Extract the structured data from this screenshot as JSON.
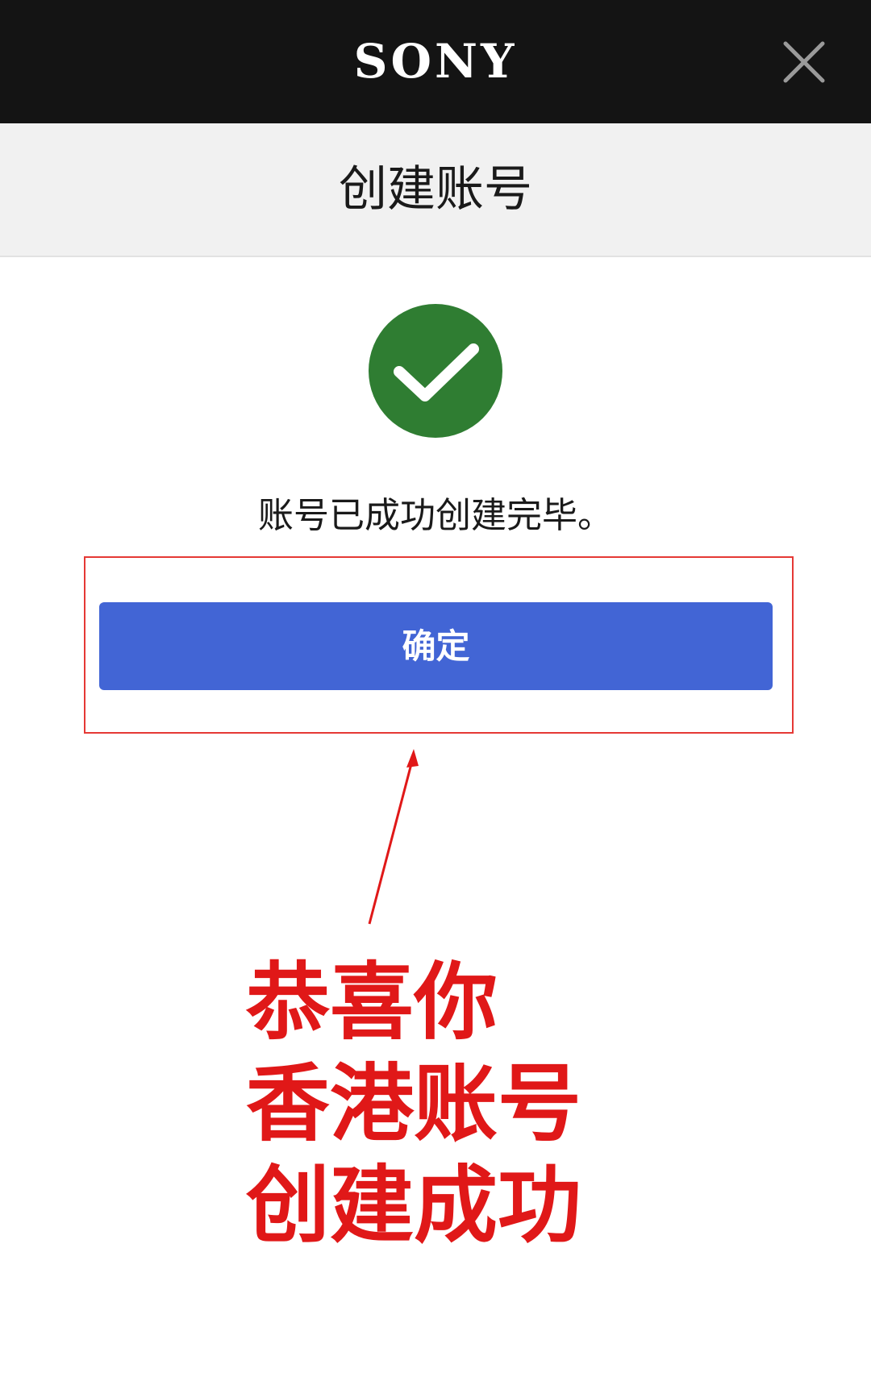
{
  "header": {
    "brand": "SONY",
    "close_icon": "close-icon"
  },
  "title_band": {
    "title": "创建账号"
  },
  "content": {
    "success_icon": "checkmark-circle-icon",
    "success_color": "#2f7d32",
    "message": "账号已成功创建完毕。",
    "confirm_label": "确定",
    "button_color": "#4265d5"
  },
  "annotation": {
    "color": "#e01818",
    "lines": [
      "恭喜你",
      "香港账号",
      "创建成功"
    ]
  }
}
